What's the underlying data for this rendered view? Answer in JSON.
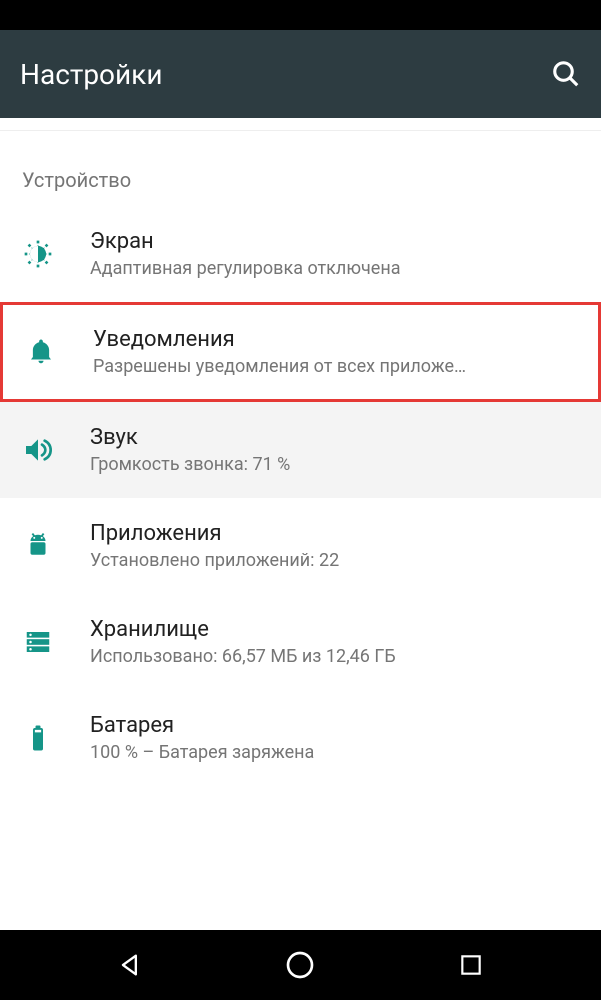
{
  "header": {
    "title": "Настройки"
  },
  "section": {
    "label": "Устройство"
  },
  "items": [
    {
      "title": "Экран",
      "subtitle": "Адаптивная регулировка отключена"
    },
    {
      "title": "Уведомления",
      "subtitle": "Разрешены уведомления от всех приложе…"
    },
    {
      "title": "Звук",
      "subtitle": "Громкость звонка: 71 %"
    },
    {
      "title": "Приложения",
      "subtitle": "Установлено приложений: 22"
    },
    {
      "title": "Хранилище",
      "subtitle": "Использовано: 66,57 МБ из 12,46 ГБ"
    },
    {
      "title": "Батарея",
      "subtitle": "100 % – Батарея заряжена"
    }
  ],
  "colors": {
    "accent": "#159588",
    "highlight": "#e53935"
  }
}
